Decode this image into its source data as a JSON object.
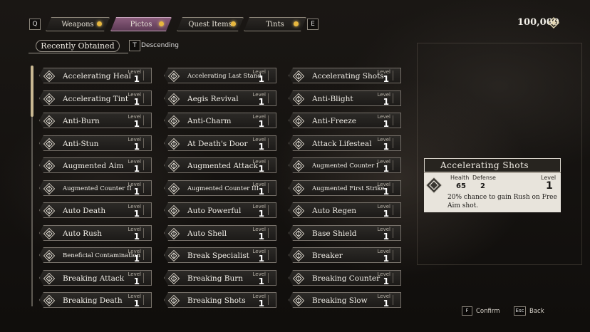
{
  "tabs": {
    "prev_key": "Q",
    "next_key": "E",
    "items": [
      {
        "label": "Weapons",
        "dot": true,
        "active": false
      },
      {
        "label": "Pictos",
        "dot": true,
        "active": true
      },
      {
        "label": "Quest Items",
        "dot": true,
        "active": false
      },
      {
        "label": "Tints",
        "dot": true,
        "active": false
      }
    ]
  },
  "currency": {
    "value": "100,000",
    "icon": "chroma-icon"
  },
  "sort": {
    "current": "Recently Obtained",
    "toggle_key": "T",
    "order": "Descending"
  },
  "pictos": [
    [
      {
        "name": "Accelerating Heal",
        "level_label": "Level",
        "level": "1"
      },
      {
        "name": "Accelerating Last Stand",
        "level_label": "Level",
        "level": "1",
        "small": true
      },
      {
        "name": "Accelerating Shots",
        "level_label": "Level",
        "level": "1"
      }
    ],
    [
      {
        "name": "Accelerating Tint",
        "level_label": "Level",
        "level": "1"
      },
      {
        "name": "Aegis Revival",
        "level_label": "Level",
        "level": "1"
      },
      {
        "name": "Anti-Blight",
        "level_label": "Level",
        "level": "1"
      }
    ],
    [
      {
        "name": "Anti-Burn",
        "level_label": "Level",
        "level": "1"
      },
      {
        "name": "Anti-Charm",
        "level_label": "Level",
        "level": "1"
      },
      {
        "name": "Anti-Freeze",
        "level_label": "Level",
        "level": "1"
      }
    ],
    [
      {
        "name": "Anti-Stun",
        "level_label": "Level",
        "level": "1"
      },
      {
        "name": "At Death's Door",
        "level_label": "Level",
        "level": "1"
      },
      {
        "name": "Attack Lifesteal",
        "level_label": "Level",
        "level": "1"
      }
    ],
    [
      {
        "name": "Augmented Aim",
        "level_label": "Level",
        "level": "1"
      },
      {
        "name": "Augmented Attack",
        "level_label": "Level",
        "level": "1"
      },
      {
        "name": "Augmented Counter I",
        "level_label": "Level",
        "level": "1",
        "small": true
      }
    ],
    [
      {
        "name": "Augmented Counter II",
        "level_label": "Level",
        "level": "1",
        "small": true
      },
      {
        "name": "Augmented Counter III",
        "level_label": "Level",
        "level": "1",
        "small": true
      },
      {
        "name": "Augmented First Strike",
        "level_label": "Level",
        "level": "1",
        "small": true
      }
    ],
    [
      {
        "name": "Auto Death",
        "level_label": "Level",
        "level": "1"
      },
      {
        "name": "Auto Powerful",
        "level_label": "Level",
        "level": "1"
      },
      {
        "name": "Auto Regen",
        "level_label": "Level",
        "level": "1"
      }
    ],
    [
      {
        "name": "Auto Rush",
        "level_label": "Level",
        "level": "1"
      },
      {
        "name": "Auto Shell",
        "level_label": "Level",
        "level": "1"
      },
      {
        "name": "Base Shield",
        "level_label": "Level",
        "level": "1"
      }
    ],
    [
      {
        "name": "Beneficial Contamination",
        "level_label": "Level",
        "level": "1",
        "small": true
      },
      {
        "name": "Break Specialist",
        "level_label": "Level",
        "level": "1"
      },
      {
        "name": "Breaker",
        "level_label": "Level",
        "level": "1"
      }
    ],
    [
      {
        "name": "Breaking Attack",
        "level_label": "Level",
        "level": "1"
      },
      {
        "name": "Breaking Burn",
        "level_label": "Level",
        "level": "1"
      },
      {
        "name": "Breaking Counter",
        "level_label": "Level",
        "level": "1"
      }
    ],
    [
      {
        "name": "Breaking Death",
        "level_label": "Level",
        "level": "1"
      },
      {
        "name": "Breaking Shots",
        "level_label": "Level",
        "level": "1"
      },
      {
        "name": "Breaking Slow",
        "level_label": "Level",
        "level": "1"
      }
    ]
  ],
  "detail": {
    "title": "Accelerating Shots",
    "health_label": "Health",
    "health": "65",
    "defense_label": "Defense",
    "defense": "2",
    "level_label": "Level",
    "level": "1",
    "description": "20% chance to gain Rush on Free Aim shot."
  },
  "hints": [
    {
      "key": "F",
      "label": "Confirm"
    },
    {
      "key": "Esc",
      "label": "Back"
    }
  ]
}
